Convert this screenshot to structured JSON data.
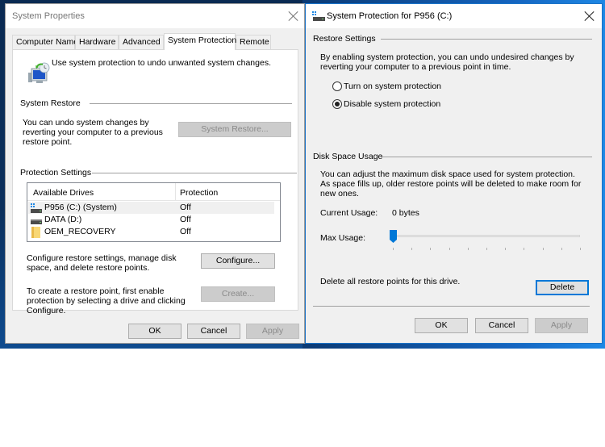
{
  "system_properties": {
    "title": "System Properties",
    "tabs": [
      {
        "label": "Computer Name",
        "active": false
      },
      {
        "label": "Hardware",
        "active": false
      },
      {
        "label": "Advanced",
        "active": false
      },
      {
        "label": "System Protection",
        "active": true
      },
      {
        "label": "Remote",
        "active": false
      }
    ],
    "intro": "Use system protection to undo unwanted system changes.",
    "system_restore": {
      "label": "System Restore",
      "description": "You can undo system changes by reverting your computer to a previous restore point.",
      "button": "System Restore...",
      "button_enabled": false
    },
    "protection_settings": {
      "label": "Protection Settings",
      "columns": [
        "Available Drives",
        "Protection"
      ],
      "drives": [
        {
          "name": "P956 (C:) (System)",
          "protection": "Off",
          "icon": "system-drive-icon",
          "selected": true
        },
        {
          "name": "DATA (D:)",
          "protection": "Off",
          "icon": "drive-icon",
          "selected": false
        },
        {
          "name": "OEM_RECOVERY",
          "protection": "Off",
          "icon": "folder-icon",
          "selected": false
        }
      ],
      "configure_text": "Configure restore settings, manage disk space, and delete restore points.",
      "configure_button": "Configure...",
      "create_text": "To create a restore point, first enable protection by selecting a drive and clicking Configure.",
      "create_button": "Create...",
      "create_enabled": false
    },
    "buttons": {
      "ok": "OK",
      "cancel": "Cancel",
      "apply": "Apply"
    }
  },
  "system_protection_dialog": {
    "title": "System Protection for P956 (C:)",
    "restore_settings": {
      "label": "Restore Settings",
      "description": "By enabling system protection, you can undo undesired changes by reverting your computer to a previous point in time.",
      "options": [
        {
          "label": "Turn on system protection",
          "checked": false
        },
        {
          "label": "Disable system protection",
          "checked": true
        }
      ]
    },
    "disk_space_usage": {
      "label": "Disk Space Usage",
      "description": "You can adjust the maximum disk space used for system protection. As space fills up, older restore points will be deleted to make room for new ones.",
      "current_usage_label": "Current Usage:",
      "current_usage_value": "0 bytes",
      "max_usage_label": "Max Usage:",
      "max_usage_fraction": 0,
      "slider_ticks": 11
    },
    "delete_text": "Delete all restore points for this drive.",
    "delete_button": "Delete",
    "buttons": {
      "ok": "OK",
      "cancel": "Cancel",
      "apply": "Apply"
    },
    "accent": "#0078d7"
  }
}
